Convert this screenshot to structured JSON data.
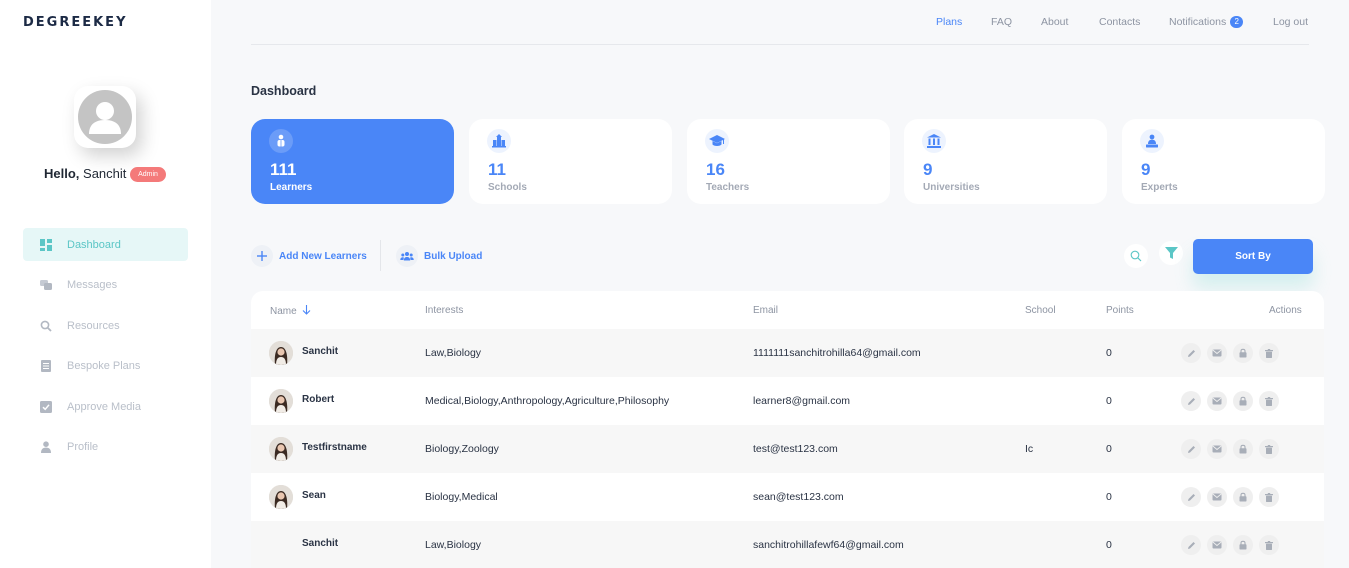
{
  "app": {
    "logo": "DEGREEKEY"
  },
  "user": {
    "greeting": "Hello,",
    "name": "Sanchit",
    "role_badge": "Admin"
  },
  "sidebar": {
    "items": [
      {
        "label": "Dashboard",
        "icon": "dashboard-icon",
        "active": true
      },
      {
        "label": "Messages",
        "icon": "messages-icon"
      },
      {
        "label": "Resources",
        "icon": "search-icon"
      },
      {
        "label": "Bespoke Plans",
        "icon": "document-icon"
      },
      {
        "label": "Approve Media",
        "icon": "check-square-icon"
      },
      {
        "label": "Profile",
        "icon": "user-icon"
      }
    ]
  },
  "topnav": {
    "plans": "Plans",
    "faq": "FAQ",
    "about": "About",
    "contacts": "Contacts",
    "notifications": "Notifications",
    "notifications_count": "2",
    "logout": "Log out"
  },
  "page": {
    "title": "Dashboard"
  },
  "cards": [
    {
      "value": "111",
      "label": "Learners",
      "icon": "learner-icon"
    },
    {
      "value": "11",
      "label": "Schools",
      "icon": "school-icon"
    },
    {
      "value": "16",
      "label": "Teachers",
      "icon": "graduation-cap-icon"
    },
    {
      "value": "9",
      "label": "Universities",
      "icon": "university-icon"
    },
    {
      "value": "9",
      "label": "Experts",
      "icon": "expert-icon"
    }
  ],
  "actions": {
    "add_new": "Add New Learners",
    "bulk_upload": "Bulk Upload",
    "sort_by": "Sort By"
  },
  "table": {
    "columns": {
      "name": "Name",
      "interests": "Interests",
      "email": "Email",
      "school": "School",
      "points": "Points",
      "actions": "Actions"
    },
    "rows": [
      {
        "name": "Sanchit",
        "interests": "Law,Biology",
        "email": "1111111sanchitrohilla64@gmail.com",
        "school": "",
        "points": "0"
      },
      {
        "name": "Robert",
        "interests": "Medical,Biology,Anthropology,Agriculture,Philosophy",
        "email": "learner8@gmail.com",
        "school": "",
        "points": "0"
      },
      {
        "name": "Testfirstname",
        "interests": "Biology,Zoology",
        "email": "test@test123.com",
        "school": "Ic",
        "points": "0"
      },
      {
        "name": "Sean",
        "interests": "Biology,Medical",
        "email": "sean@test123.com",
        "school": "",
        "points": "0"
      },
      {
        "name": "Sanchit",
        "interests": "Law,Biology",
        "email": "sanchitrohillafewf64@gmail.com",
        "school": "",
        "points": "0"
      }
    ]
  },
  "colors": {
    "accent": "#4a86f7",
    "teal": "#5bc6c6",
    "badge": "#f47a7a"
  }
}
